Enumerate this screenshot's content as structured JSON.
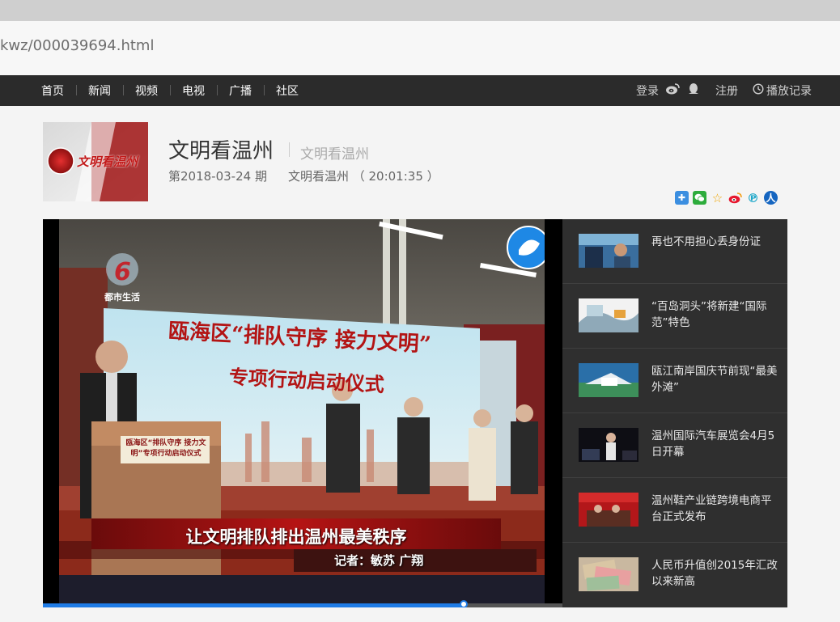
{
  "browser": {
    "url": "kwz/000039694.html"
  },
  "nav": {
    "items": [
      "首页",
      "新闻",
      "视频",
      "电视",
      "广播",
      "社区"
    ],
    "login": "登录",
    "register": "注册",
    "history": "播放记录"
  },
  "show": {
    "title": "文明看温州",
    "subtitle": "文明看温州",
    "episode": "第2018-03-24 期",
    "program_info": "文明看温州 （ 20:01:35 ）",
    "logo_text": "文明看温州"
  },
  "share_icons": [
    "qzone-icon",
    "wechat-icon",
    "favorite-icon",
    "weibo-icon",
    "pinterest-icon",
    "renren-icon"
  ],
  "video": {
    "channel_logo": "都市生活",
    "banner_line1": "瓯海区“排队守序 接力文明”",
    "banner_line2": "专项行动启动仪式",
    "podium_text": "瓯海区“排队守序 接力文明”专项行动启动仪式",
    "caption": "让文明排队排出温州最美秩序",
    "reporter": "记者：敏苏 广翔",
    "progress": 0.81
  },
  "sidebar": {
    "items": [
      {
        "title": "再也不用担心丢身份证"
      },
      {
        "title": "“百岛洞头”将新建“国际范”特色"
      },
      {
        "title": "瓯江南岸国庆节前现“最美外滩”"
      },
      {
        "title": "温州国际汽车展览会4月5日开幕"
      },
      {
        "title": "温州鞋产业链跨境电商平台正式发布"
      },
      {
        "title": "人民币升值创2015年汇改以来新高"
      }
    ]
  },
  "colors": {
    "nav_bg": "#2b2b2b",
    "progress": "#1e7be6",
    "sidebar_bg": "#2f2f2f"
  }
}
